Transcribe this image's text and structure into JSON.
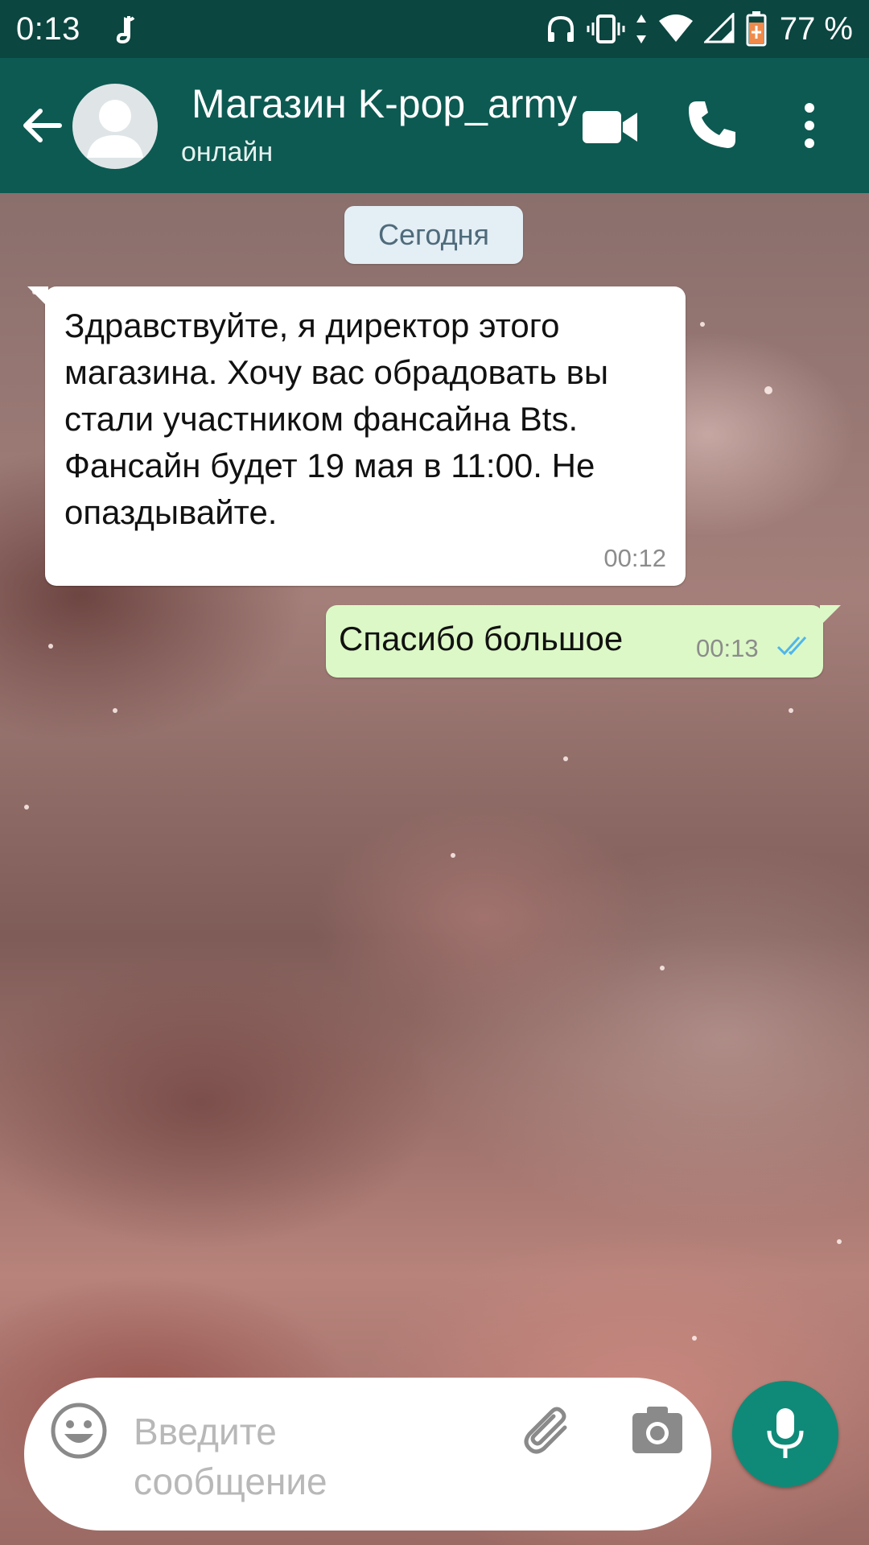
{
  "status_bar": {
    "time": "0:13",
    "battery": "77 %",
    "icons": [
      "notification-icon",
      "headphones-icon",
      "vibrate-icon",
      "data-arrows-icon",
      "wifi-icon",
      "signal-icon",
      "battery-icon"
    ]
  },
  "header": {
    "contact_name": "Магазин K-pop_army",
    "status": "онлайн",
    "icons": [
      "back-arrow-icon",
      "avatar-icon",
      "video-call-icon",
      "phone-icon",
      "more-vert-icon"
    ],
    "bg_color": "#0d5a52"
  },
  "chat": {
    "date_label": "Сегодня",
    "messages": [
      {
        "direction": "incoming",
        "text": "Здравствуйте, я директор этого магазина. Хочу вас обрадовать вы стали участником фансайна Bts. Фансайн будет 19 мая в 11:00. Не опаздывайте.",
        "time": "00:12"
      },
      {
        "direction": "outgoing",
        "text": "Спасибо большое",
        "time": "00:13",
        "status_icon": "double-check-read-icon"
      }
    ]
  },
  "input_bar": {
    "placeholder": "Введите сообщение",
    "icons": [
      "emoji-icon",
      "attach-icon",
      "camera-icon",
      "mic-icon"
    ],
    "accent_color": "#0f8a78"
  }
}
